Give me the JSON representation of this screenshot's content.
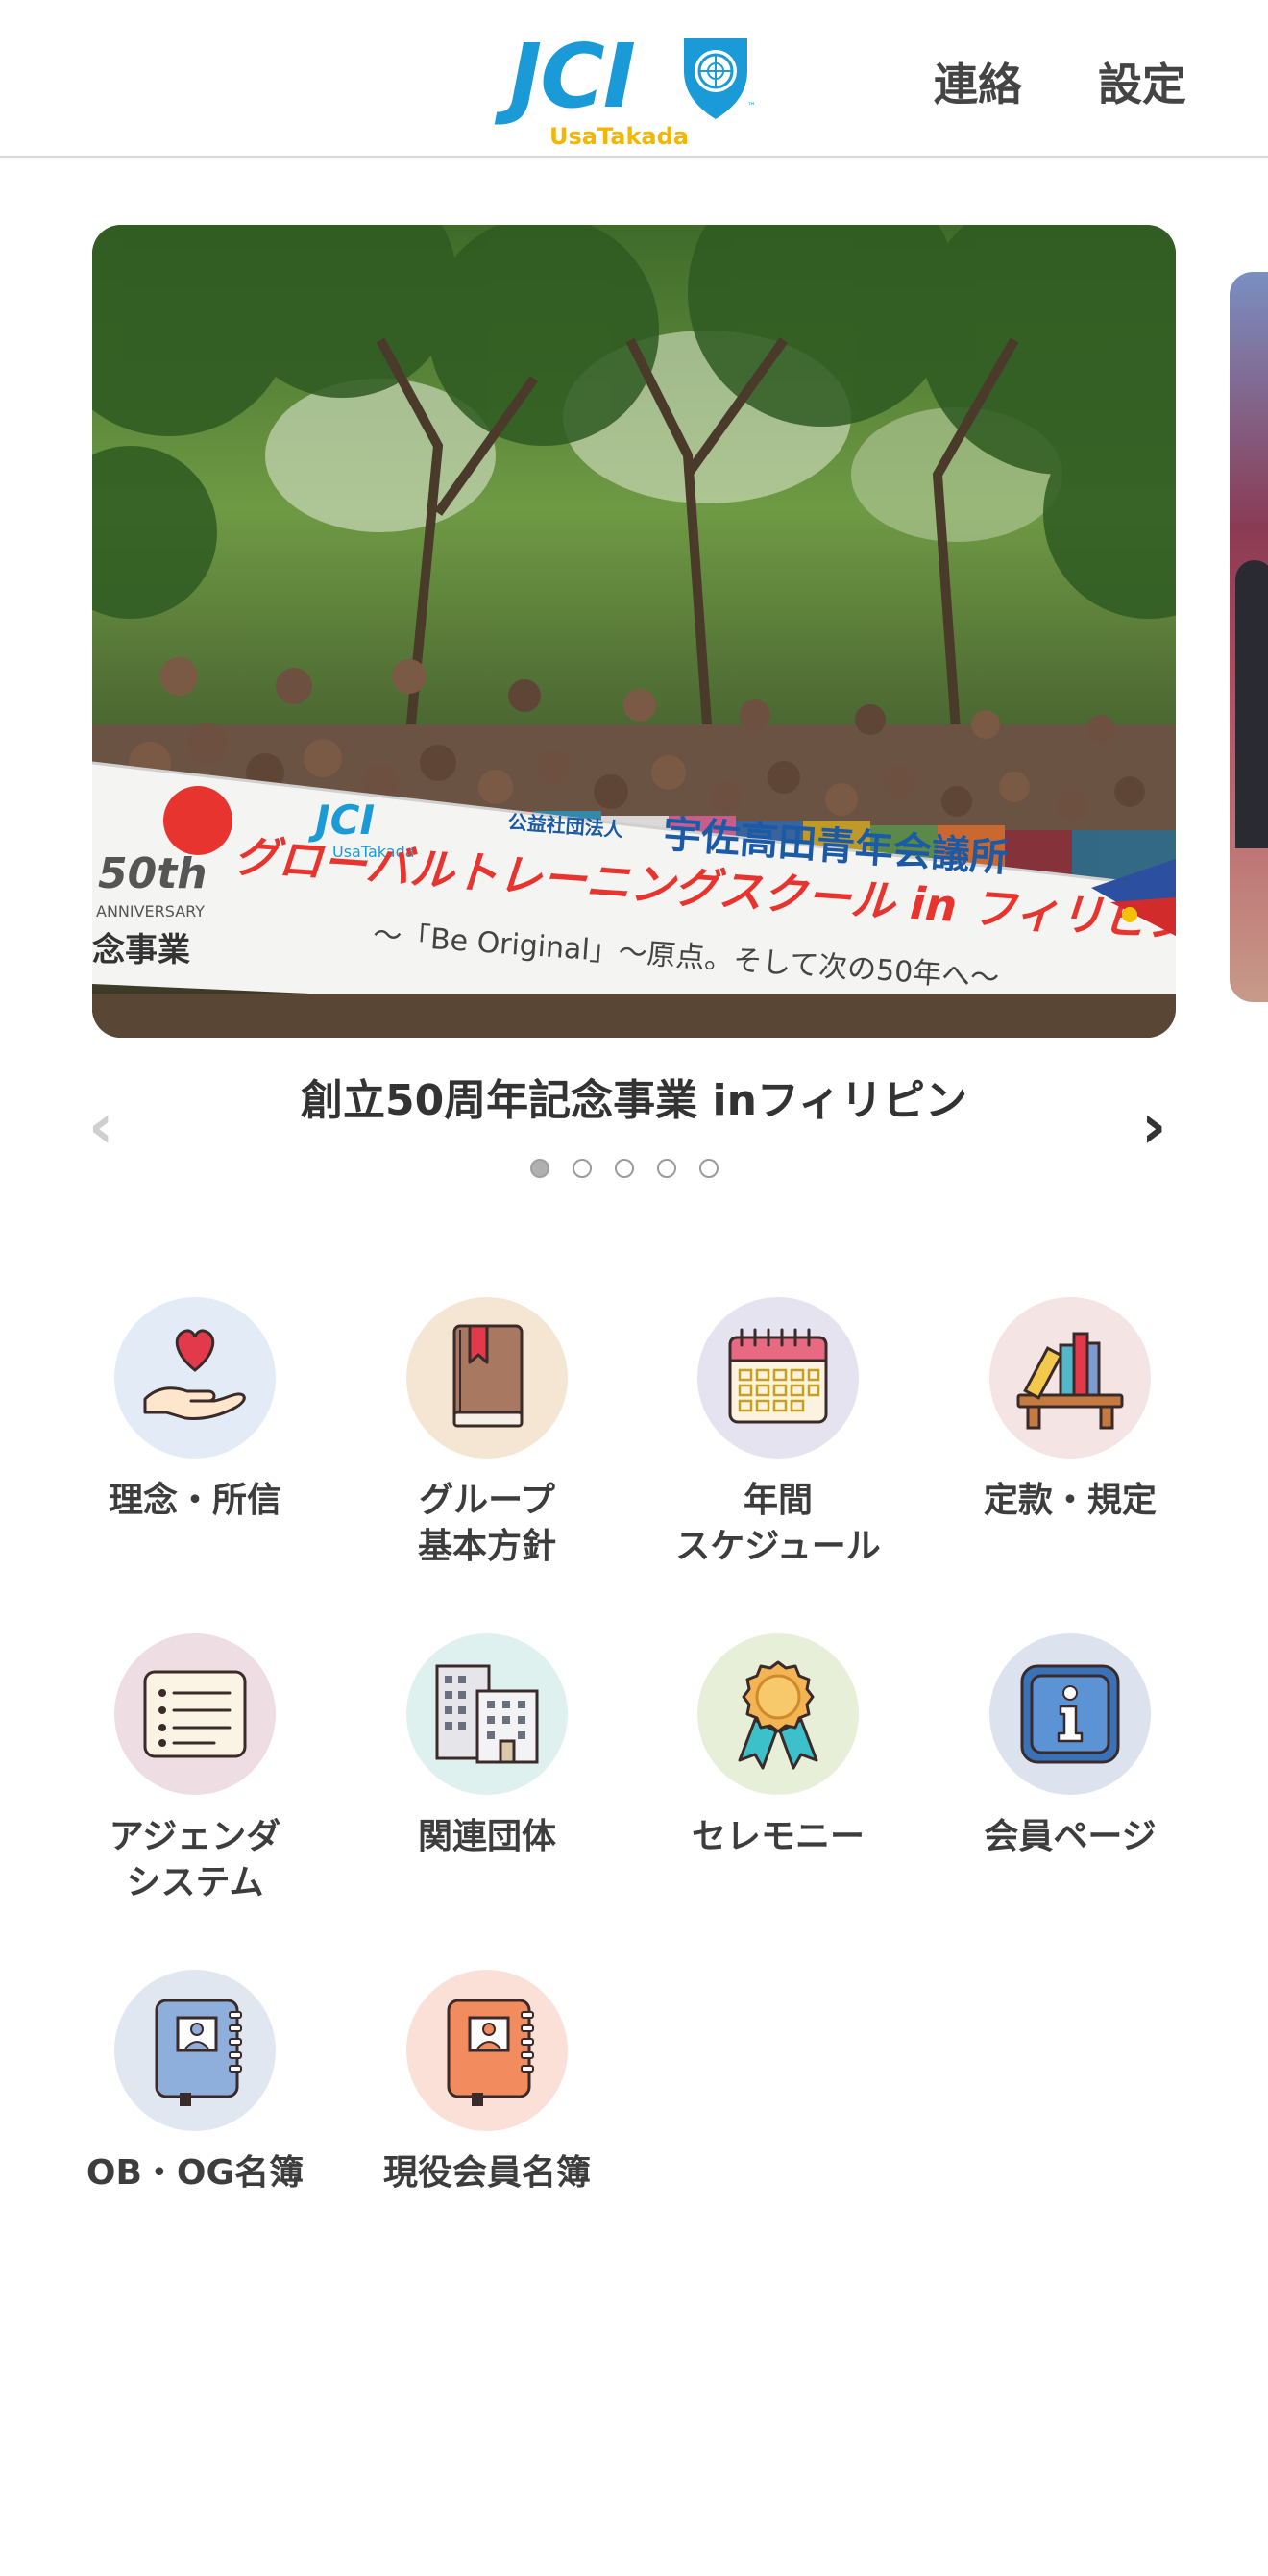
{
  "header": {
    "logo_text": "JCI",
    "logo_subtitle": "UsaTakada",
    "logo_tm": "™",
    "nav_contact": "連絡",
    "nav_settings": "設定"
  },
  "carousel": {
    "banner": {
      "org_small": "公益社団法人",
      "org_name": "宇佐高田青年会議所",
      "title": "グローバルトレーニングスクール in フィリピン",
      "subtitle": "〜「Be Original」〜原点。そして次の50年へ〜",
      "anniversary": "50th",
      "anniversary_word": "ANNIVERSARY",
      "project": "念事業",
      "logo_text": "JCI",
      "logo_subtitle": "UsaTakada"
    },
    "caption": "創立50周年記念事業 inフィリピン",
    "prev_arrow": "‹",
    "next_arrow": "›",
    "slide_count": 5,
    "active_index": 0
  },
  "menu": [
    {
      "label": "理念・所信",
      "icon": "heart-hand-icon",
      "bg": "#e3ecf6"
    },
    {
      "label": "グループ\n基本方針",
      "icon": "book-icon",
      "bg": "#f5e6d3"
    },
    {
      "label": "年間\nスケジュール",
      "icon": "calendar-icon",
      "bg": "#e6e3f1"
    },
    {
      "label": "定款・規定",
      "icon": "bookshelf-icon",
      "bg": "#f5e4e4"
    },
    {
      "label": "アジェンダ\nシステム",
      "icon": "agenda-list-icon",
      "bg": "#eedde2"
    },
    {
      "label": "関連団体",
      "icon": "buildings-icon",
      "bg": "#dff1ef"
    },
    {
      "label": "セレモニー",
      "icon": "medal-icon",
      "bg": "#e8efd8"
    },
    {
      "label": "会員ページ",
      "icon": "info-icon",
      "bg": "#dde3ee"
    },
    {
      "label": "OB・OG名簿",
      "icon": "blue-address-book-icon",
      "bg": "#e1e7f0"
    },
    {
      "label": "現役会員名簿",
      "icon": "orange-address-book-icon",
      "bg": "#fbe0d8"
    }
  ],
  "colors": {
    "jci_blue": "#1a9ad6",
    "jci_yellow": "#f2b705",
    "banner_red": "#e8342f"
  }
}
